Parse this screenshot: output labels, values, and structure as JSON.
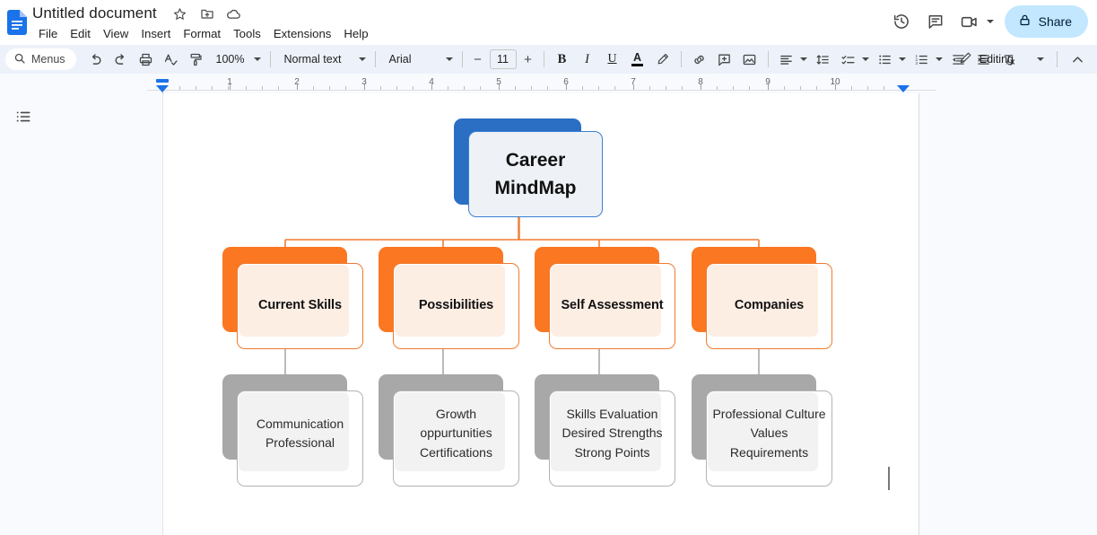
{
  "titlebar": {
    "doc_title": "Untitled document",
    "icons": [
      {
        "name": "star-icon",
        "glyph": "☆"
      },
      {
        "name": "move-to-folder-icon",
        "glyph": "▣"
      },
      {
        "name": "cloud-saved-icon",
        "glyph": "☁"
      }
    ],
    "menus": [
      "File",
      "Edit",
      "View",
      "Insert",
      "Format",
      "Tools",
      "Extensions",
      "Help"
    ],
    "right_actions": [
      {
        "name": "version-history-icon",
        "label": "Version history"
      },
      {
        "name": "comment-history-icon",
        "label": "Comments"
      },
      {
        "name": "meet-camera-icon",
        "label": "Join a call"
      }
    ],
    "share_label": "Share"
  },
  "toolbar": {
    "menus_label": "Menus",
    "zoom_value": "100%",
    "paragraph_style": "Normal text",
    "font_family": "Arial",
    "font_size": "11",
    "mode_label": "Editing",
    "left_icons": [
      {
        "name": "undo-icon"
      },
      {
        "name": "redo-icon"
      },
      {
        "name": "print-icon"
      },
      {
        "name": "spelling-check-icon"
      },
      {
        "name": "paint-format-icon"
      }
    ],
    "format_icons": [
      {
        "name": "bold-icon",
        "glyph": "B"
      },
      {
        "name": "italic-icon",
        "glyph": "I"
      },
      {
        "name": "underline-icon",
        "glyph": "U"
      },
      {
        "name": "text-color-icon",
        "glyph": "A"
      },
      {
        "name": "highlight-color-icon"
      }
    ],
    "insert_icons": [
      {
        "name": "insert-link-icon"
      },
      {
        "name": "add-comment-icon"
      },
      {
        "name": "insert-image-icon"
      }
    ],
    "paragraph_icons": [
      {
        "name": "align-icon"
      },
      {
        "name": "line-spacing-icon"
      },
      {
        "name": "checklist-icon"
      },
      {
        "name": "bulleted-list-icon"
      },
      {
        "name": "numbered-list-icon"
      },
      {
        "name": "decrease-indent-icon"
      },
      {
        "name": "increase-indent-icon"
      },
      {
        "name": "clear-formatting-icon"
      }
    ]
  },
  "ruler": {
    "numbers": [
      "1",
      "2",
      "3",
      "4",
      "5",
      "6",
      "7",
      "8",
      "9",
      "10"
    ]
  },
  "sidebar": {
    "outline_label": "Show document outline"
  },
  "chart_data": {
    "type": "diagram",
    "title": "Career MindMap",
    "layout": "top-down tree, 3 levels",
    "colors": {
      "root_shadow": "#2a6fc4",
      "root_border": "#3c7fd0",
      "root_fill": "#eef2f7",
      "level2_shadow": "#fb7722",
      "level2_border": "#f07b30",
      "level2_inner": "#fdeee4",
      "level3_shadow": "#a8a8a8",
      "level3_border": "#b3b3b3",
      "level3_inner": "#f2f2f2",
      "connector_orange": "#f07b30",
      "connector_gray": "#a8a8a8"
    },
    "nodes": {
      "root": {
        "label": "Career MindMap",
        "level": 1
      },
      "level2": [
        {
          "label": "Current Skills"
        },
        {
          "label": "Possibilities"
        },
        {
          "label": "Self Assessment"
        },
        {
          "label": "Companies"
        }
      ],
      "level3": [
        {
          "lines": [
            "Communication",
            "Professional"
          ]
        },
        {
          "lines": [
            "Growth",
            "oppurtunities",
            "Certifications"
          ]
        },
        {
          "lines": [
            "Skills Evaluation",
            "Desired Strengths",
            "Strong Points"
          ]
        },
        {
          "lines": [
            "Professional Culture",
            "Values",
            "Requirements"
          ]
        }
      ]
    }
  }
}
